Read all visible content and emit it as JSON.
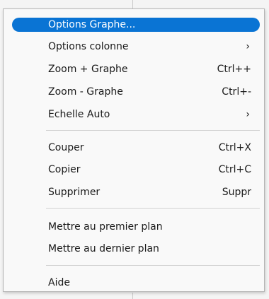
{
  "menu": {
    "items": [
      {
        "label": "Options Graphe...",
        "shortcut": ""
      },
      {
        "label": "Options colonne",
        "submenu": "›"
      },
      {
        "label": "Zoom + Graphe",
        "shortcut": "Ctrl++"
      },
      {
        "label": "Zoom - Graphe",
        "shortcut": "Ctrl+-"
      },
      {
        "label": "Echelle Auto",
        "submenu": "›"
      },
      {
        "label": "Couper",
        "shortcut": "Ctrl+X"
      },
      {
        "label": "Copier",
        "shortcut": "Ctrl+C"
      },
      {
        "label": "Supprimer",
        "shortcut": "Suppr"
      },
      {
        "label": "Mettre au premier plan",
        "shortcut": ""
      },
      {
        "label": "Mettre au dernier plan",
        "shortcut": ""
      },
      {
        "label": "Aide",
        "shortcut": ""
      }
    ]
  },
  "colors": {
    "highlight": "#0a74d4"
  }
}
